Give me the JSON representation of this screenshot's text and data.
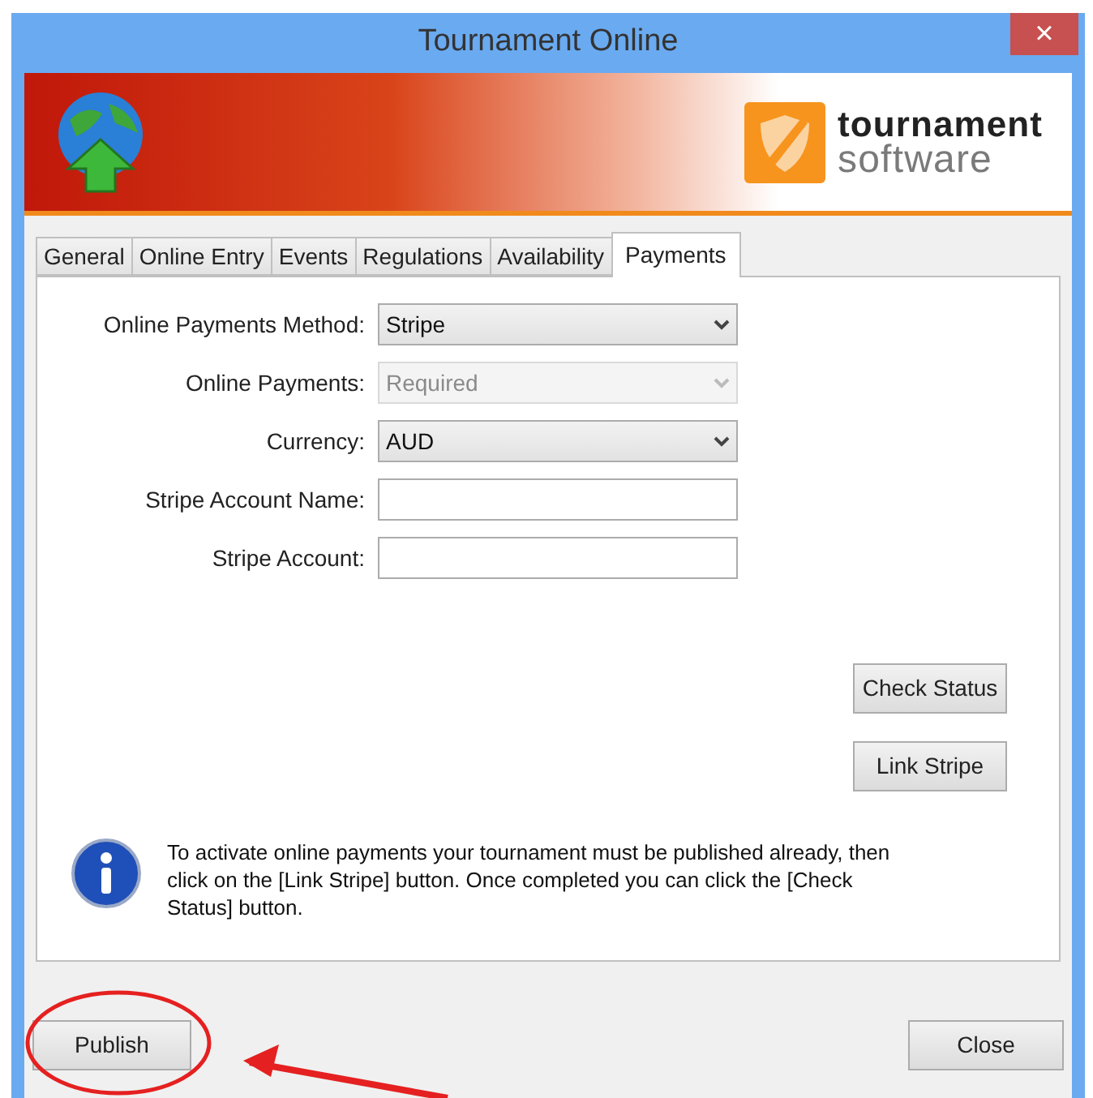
{
  "window": {
    "title": "Tournament Online",
    "close": "×"
  },
  "logo": {
    "line1": "tournament",
    "line2": "software"
  },
  "tabs": [
    {
      "label": "General",
      "selected": false
    },
    {
      "label": "Online Entry",
      "selected": false
    },
    {
      "label": "Events",
      "selected": false
    },
    {
      "label": "Regulations",
      "selected": false
    },
    {
      "label": "Availability",
      "selected": false
    },
    {
      "label": "Payments",
      "selected": true
    }
  ],
  "fields": [
    {
      "label": "Online Payments Method:",
      "kind": "select",
      "value": "Stripe",
      "disabled": false
    },
    {
      "label": "Online Payments:",
      "kind": "select",
      "value": "Required",
      "disabled": true
    },
    {
      "label": "Currency:",
      "kind": "select",
      "value": "AUD",
      "disabled": false
    },
    {
      "label": "Stripe Account Name:",
      "kind": "text",
      "disabled": false
    },
    {
      "label": "Stripe Account:",
      "kind": "text",
      "disabled": false
    }
  ],
  "side_buttons": [
    "Check Status",
    "Link Stripe"
  ],
  "info": "To activate online payments your tournament must be published already, then click on the [Link Stripe] button. Once completed you can click the [Check Status] button.",
  "footer_buttons": {
    "left": "Publish",
    "right": "Close"
  }
}
